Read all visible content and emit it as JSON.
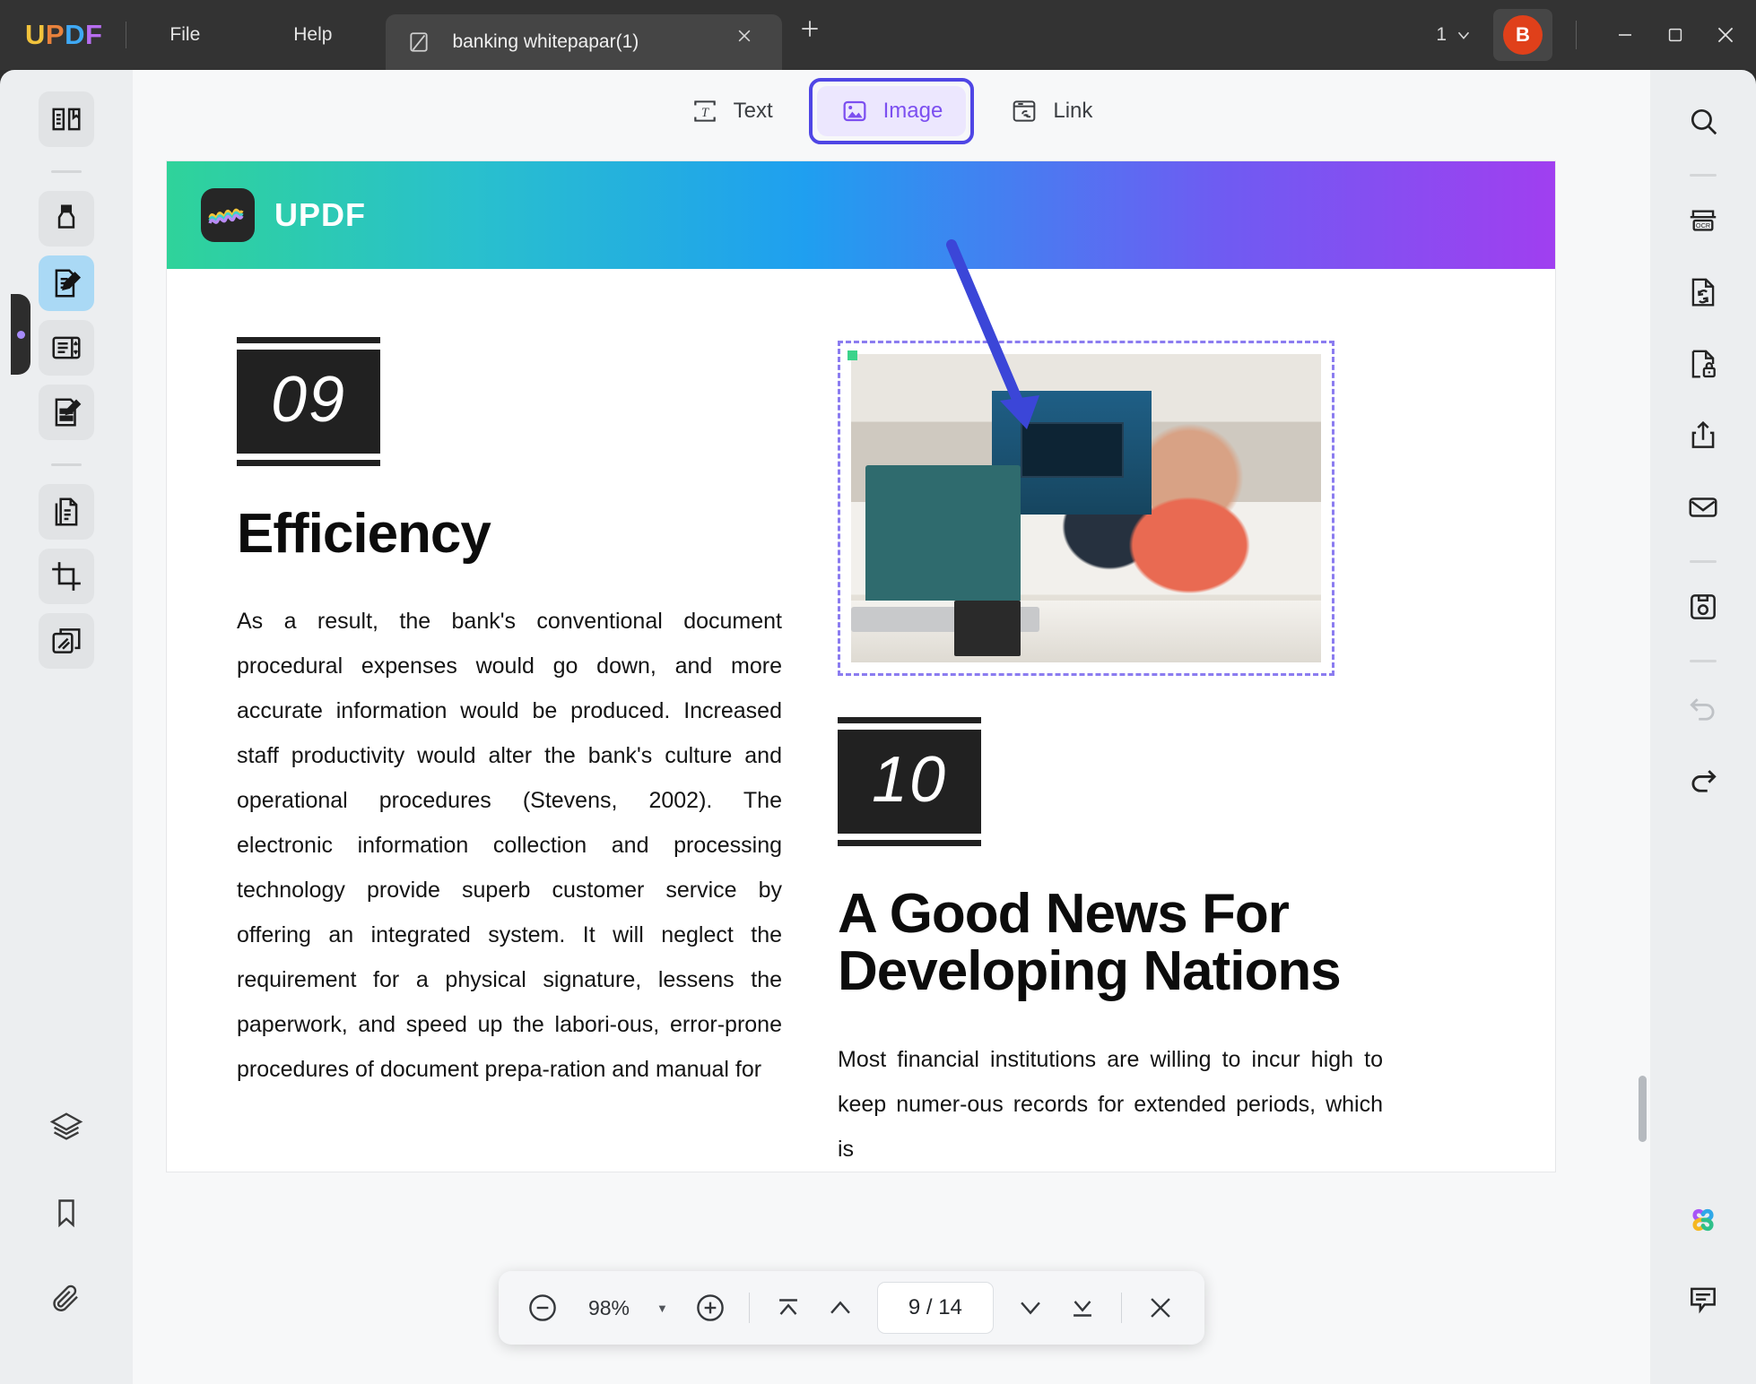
{
  "titlebar": {
    "brand_letters": [
      "U",
      "P",
      "D",
      "F"
    ],
    "menus": [
      {
        "label": "File",
        "name": "menu-file"
      },
      {
        "label": "Help",
        "name": "menu-help"
      }
    ],
    "tab": {
      "title": "banking whitepapar(1)",
      "file_icon": "pdf-file-icon",
      "close_icon": "close-icon",
      "new_tab_icon": "plus-icon"
    },
    "window": {
      "tab_count": "1",
      "chevron_icon": "chevron-down-icon",
      "avatar_initial": "B",
      "avatar_color": "#e0401a",
      "minimize_icon": "minimize-icon",
      "maximize_icon": "maximize-icon",
      "close_icon": "close-icon"
    }
  },
  "mode_bar": {
    "items": [
      {
        "label": "Text",
        "icon": "text-edit-icon",
        "active": false
      },
      {
        "label": "Image",
        "icon": "image-edit-icon",
        "active": true
      },
      {
        "label": "Link",
        "icon": "link-edit-icon",
        "active": false
      }
    ],
    "selection_outline_color": "#4f46e5",
    "active_color": "#7c4ff0"
  },
  "left_rail": {
    "top_items": [
      {
        "name": "sidebar-reader-icon",
        "icon": "book-reader-icon",
        "state": "tinted"
      },
      {
        "name": "sidebar-comment-icon",
        "icon": "highlighter-icon",
        "state": "tinted"
      },
      {
        "name": "sidebar-edit-icon",
        "icon": "edit-document-icon",
        "state": "active"
      },
      {
        "name": "sidebar-page-icon",
        "icon": "page-display-icon",
        "state": "tinted"
      },
      {
        "name": "sidebar-annotate-icon",
        "icon": "sign-document-icon",
        "state": "tinted"
      },
      {
        "name": "sidebar-organize-icon",
        "icon": "organize-pages-icon",
        "state": "tinted"
      },
      {
        "name": "sidebar-crop-icon",
        "icon": "crop-icon",
        "state": "tinted"
      },
      {
        "name": "sidebar-batch-icon",
        "icon": "batch-pages-icon",
        "state": "tinted"
      }
    ],
    "bottom_items": [
      {
        "name": "sidebar-layers-icon",
        "icon": "layers-icon"
      },
      {
        "name": "sidebar-bookmark-icon",
        "icon": "bookmark-icon"
      },
      {
        "name": "sidebar-attachment-icon",
        "icon": "paperclip-icon"
      }
    ]
  },
  "right_rail": {
    "top_items": [
      {
        "name": "search-button",
        "icon": "search-icon"
      },
      {
        "name": "ocr-button",
        "icon": "ocr-icon"
      },
      {
        "name": "convert-button",
        "icon": "convert-file-icon"
      },
      {
        "name": "protect-button",
        "icon": "lock-document-icon"
      },
      {
        "name": "share-button",
        "icon": "share-icon"
      },
      {
        "name": "email-button",
        "icon": "email-icon"
      },
      {
        "name": "save-button",
        "icon": "floppy-save-icon"
      },
      {
        "name": "undo-button",
        "icon": "undo-icon"
      },
      {
        "name": "redo-button",
        "icon": "redo-icon"
      }
    ],
    "bottom_items": [
      {
        "name": "ai-assistant-button",
        "icon": "ai-clover-icon"
      },
      {
        "name": "comment-button",
        "icon": "comment-bubble-icon"
      }
    ]
  },
  "document": {
    "banner_logo_text": "UPDF",
    "left_column": {
      "number": "09",
      "heading": "Efficiency",
      "paragraph": "As a result, the bank's conventional document procedural expenses would go down, and more accurate information would be produced. Increased staff productivity would alter the bank's culture and operational procedures (Stevens, 2002). The electronic information collection and processing technology provide superb customer service by offering an integrated system. It will neglect the requirement for a physical signature, lessens the paperwork, and speed up the labori-ous, error-prone procedures of document prepa-ration and manual for"
    },
    "right_column": {
      "image_alt": "two women working at a desk with a computer in an office",
      "image_selected": true,
      "number": "10",
      "heading": "A Good News For Developing Nations",
      "paragraph": "Most financial institutions are willing to incur high to keep numer-ous records for extended periods, which is"
    },
    "annotation": {
      "type": "arrow",
      "color": "#3b46d8"
    }
  },
  "bottom_toolbar": {
    "zoom_out_icon": "zoom-out-icon",
    "zoom_value": "98%",
    "zoom_dropdown_icon": "caret-down-icon",
    "zoom_in_icon": "zoom-in-icon",
    "first_page_icon": "first-page-icon",
    "prev_page_icon": "previous-page-icon",
    "page_indicator": "9 / 14",
    "next_page_icon": "next-page-icon",
    "last_page_icon": "last-page-icon",
    "close_icon": "close-toolbar-icon"
  }
}
